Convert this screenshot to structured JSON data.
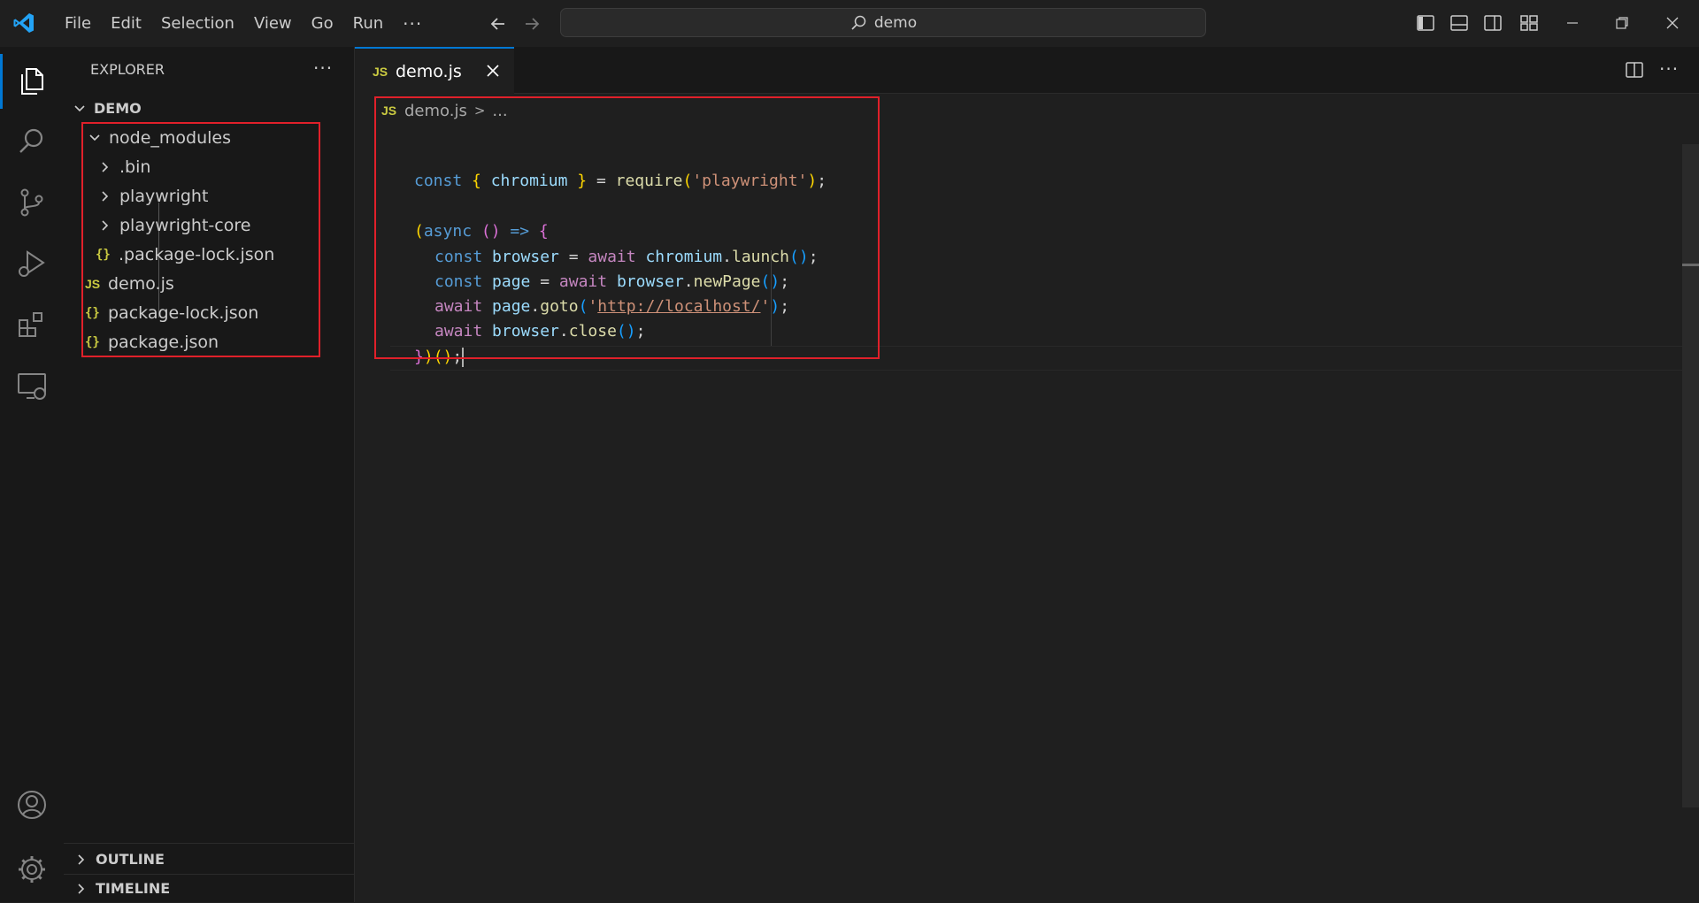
{
  "titlebar": {
    "menu": [
      "File",
      "Edit",
      "Selection",
      "View",
      "Go",
      "Run"
    ],
    "more": "···",
    "search_text": "demo",
    "icons": [
      "back-arrow-icon",
      "forward-arrow-icon",
      "search-icon",
      "toggle-primary-sidebar-icon",
      "toggle-panel-icon",
      "toggle-secondary-sidebar-icon",
      "customize-layout-icon",
      "minimize-icon",
      "restore-icon",
      "close-icon"
    ]
  },
  "activity_bar": {
    "icons": [
      "explorer-icon",
      "search-icon",
      "source-control-icon",
      "run-debug-icon",
      "extensions-icon",
      "remote-explorer-icon",
      "accounts-icon",
      "settings-gear-icon"
    ]
  },
  "sidebar": {
    "title": "EXPLORER",
    "more": "···",
    "root": "DEMO",
    "tree": [
      {
        "label": "node_modules",
        "kind": "folder",
        "expanded": true
      },
      {
        "label": ".bin",
        "kind": "folder",
        "expanded": false
      },
      {
        "label": "playwright",
        "kind": "folder",
        "expanded": false
      },
      {
        "label": "playwright-core",
        "kind": "folder",
        "expanded": false
      },
      {
        "label": ".package-lock.json",
        "kind": "json",
        "icon": "{}"
      },
      {
        "label": "demo.js",
        "kind": "js",
        "icon": "JS"
      },
      {
        "label": "package-lock.json",
        "kind": "json",
        "icon": "{}"
      },
      {
        "label": "package.json",
        "kind": "json",
        "icon": "{}"
      }
    ],
    "sections": [
      "OUTLINE",
      "TIMELINE"
    ]
  },
  "editor": {
    "tab": {
      "icon": "JS",
      "label": "demo.js"
    },
    "breadcrumb": {
      "icon": "JS",
      "file": "demo.js",
      "sep": ">",
      "rest": "..."
    },
    "more": "···"
  },
  "code": {
    "l1": {
      "a": "const",
      "b": "{",
      "c": "chromium",
      "d": "}",
      "e": " = ",
      "f": "require",
      "g": "(",
      "h": "'playwright'",
      "i": ")",
      "j": ";"
    },
    "l3": {
      "a": "(",
      "b": "async",
      "c": "()",
      "d": " => ",
      "e": "{"
    },
    "l4": {
      "a": "const",
      "b": "browser",
      "c": " = ",
      "d": "await",
      "e": "chromium",
      "f": ".",
      "g": "launch",
      "h": "()",
      "i": ";"
    },
    "l5": {
      "a": "const",
      "b": "page",
      "c": " = ",
      "d": "await",
      "e": "browser",
      "f": ".",
      "g": "newPage",
      "h": "()",
      "i": ";"
    },
    "l6": {
      "a": "await",
      "b": "page",
      "c": ".",
      "d": "goto",
      "e": "(",
      "f": "'",
      "g": "http://localhost/",
      "h": "'",
      "i": ")",
      "j": ";"
    },
    "l7": {
      "a": "await",
      "b": "browser",
      "c": ".",
      "d": "close",
      "e": "()",
      "f": ";"
    },
    "l8": {
      "a": "}",
      "b": ")",
      "c": "()",
      "d": ";"
    }
  },
  "colors": {
    "accent": "#0078d4",
    "highlight_box": "#e0202a"
  }
}
